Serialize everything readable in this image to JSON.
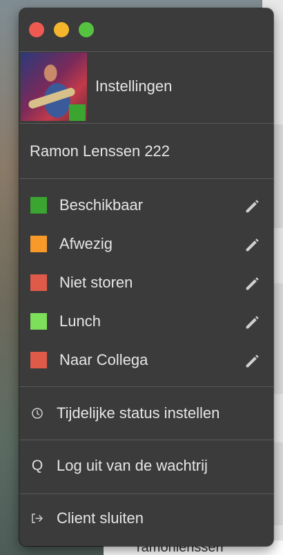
{
  "window": {
    "settings_label": "Instellingen",
    "username": "Ramon Lenssen 222",
    "avatar_status_color": "#3aa530"
  },
  "statuses": [
    {
      "label": "Beschikbaar",
      "color": "#3aa530"
    },
    {
      "label": "Afwezig",
      "color": "#f79a2a"
    },
    {
      "label": "Niet storen",
      "color": "#e05a4a"
    },
    {
      "label": "Lunch",
      "color": "#7ee05a"
    },
    {
      "label": "Naar Collega",
      "color": "#e05a4a"
    }
  ],
  "actions": {
    "temp_status": {
      "label": "Tijdelijke status instellen",
      "icon": "clock-icon"
    },
    "logout_queue": {
      "label": "Log uit van de wachtrij",
      "icon": "q-icon",
      "glyph": "Q"
    },
    "close_client": {
      "label": "Client sluiten",
      "icon": "exit-icon"
    }
  },
  "background": {
    "bottom_text": "ramonlenssen"
  }
}
